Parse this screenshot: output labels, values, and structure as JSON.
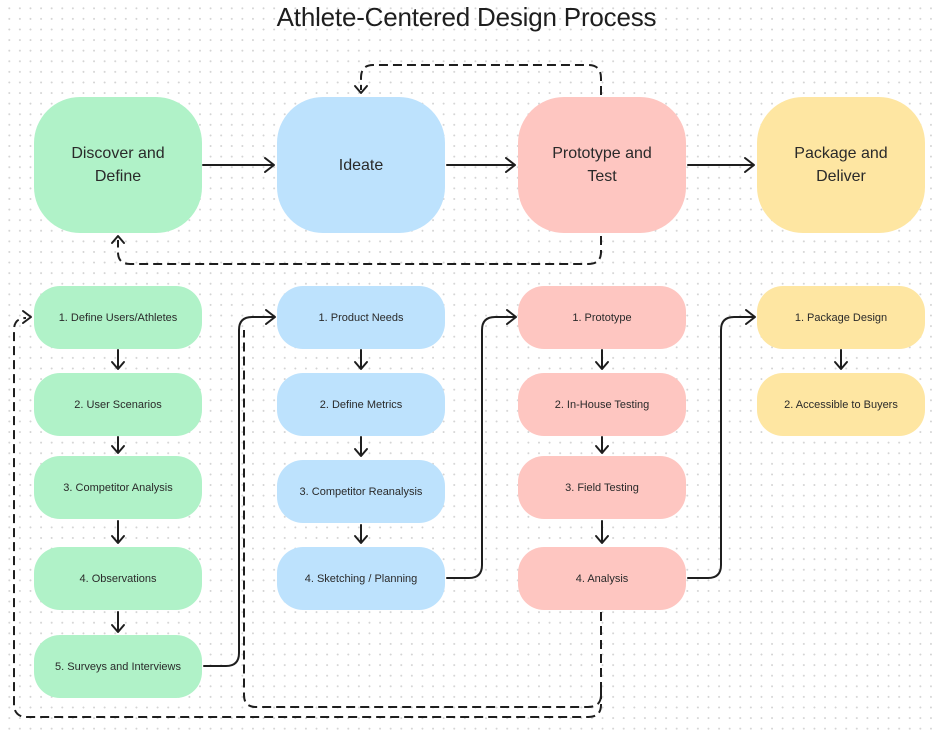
{
  "title": "Athlete-Centered Design Process",
  "colors": {
    "green": "#b0f2c8",
    "blue": "#bde2fd",
    "red": "#fec6c1",
    "yellow": "#fee6a2",
    "connector": "#1e1e1e"
  },
  "phases": [
    {
      "label": "Discover and Define",
      "color": "green",
      "steps": [
        "1. Define Users/Athletes",
        "2. User Scenarios",
        "3. Competitor Analysis",
        "4. Observations",
        "5. Surveys and Interviews"
      ]
    },
    {
      "label": "Ideate",
      "color": "blue",
      "steps": [
        "1. Product Needs",
        "2. Define Metrics",
        "3. Competitor Reanalysis",
        "4. Sketching / Planning"
      ]
    },
    {
      "label": "Prototype and Test",
      "color": "red",
      "steps": [
        "1. Prototype",
        "2. In-House Testing",
        "3. Field Testing",
        "4. Analysis"
      ]
    },
    {
      "label": "Package and Deliver",
      "color": "yellow",
      "steps": [
        "1. Package Design",
        "2. Accessible to Buyers"
      ]
    }
  ],
  "connections": {
    "solid": [
      "Discover and Define -> Ideate",
      "Ideate -> Prototype and Test",
      "Prototype and Test -> Package and Deliver",
      "5. Surveys and Interviews -> 1. Product Needs",
      "4. Sketching / Planning -> 1. Prototype",
      "4. Analysis -> 1. Package Design"
    ],
    "dashed_feedback": [
      "Prototype and Test -> Ideate",
      "Prototype and Test -> Discover and Define",
      "4. Analysis -> 1. Product Needs",
      "4. Analysis -> 1. Define Users/Athletes"
    ]
  }
}
